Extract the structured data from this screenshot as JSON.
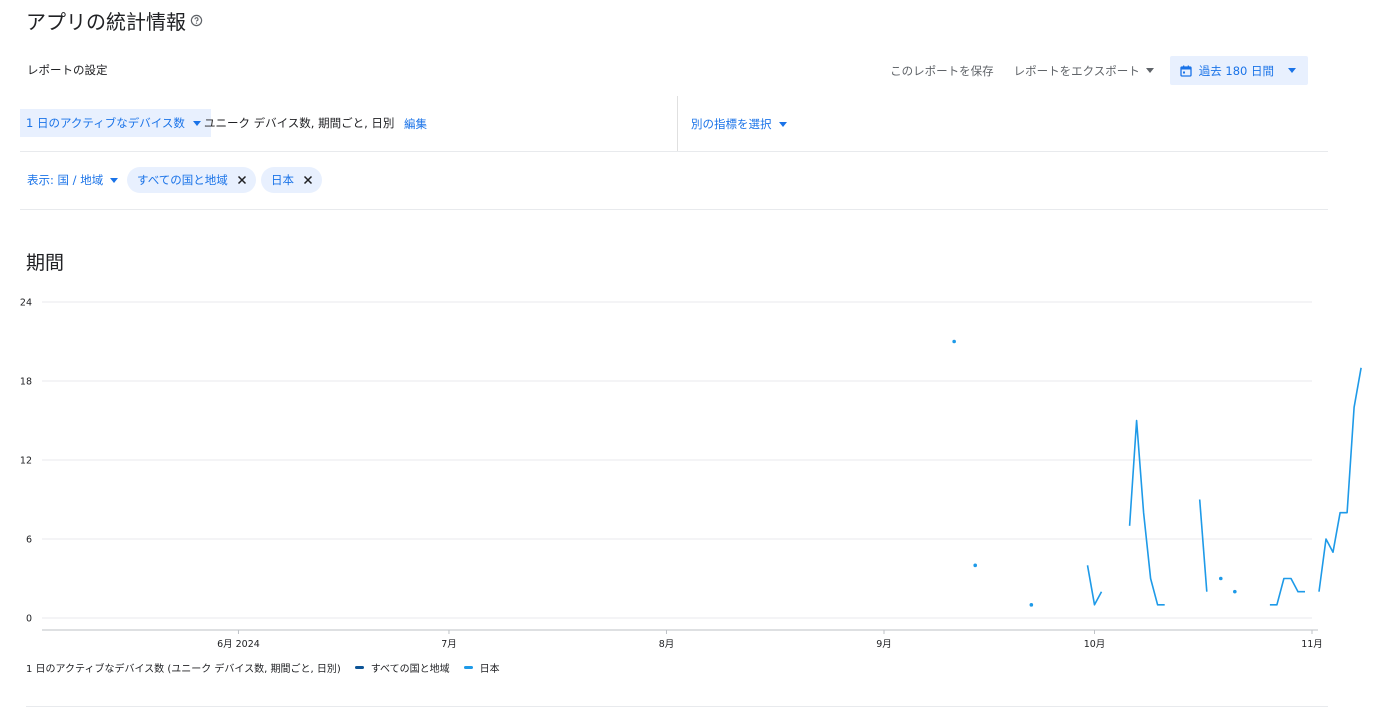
{
  "header": {
    "title": "アプリの統計情報",
    "help_icon": "help-circle-icon"
  },
  "settings": {
    "label": "レポートの設定",
    "save": "このレポートを保存",
    "export": "レポートをエクスポート",
    "date_range": "過去 180 日間",
    "calendar_icon": "calendar-icon"
  },
  "metric": {
    "selected": "1 日のアクティブなデバイス数",
    "description": "ユニーク デバイス数, 期間ごと, 日別",
    "edit": "編集",
    "other": "別の指標を選択"
  },
  "filters": {
    "display": "表示: 国 / 地域",
    "chips": [
      "すべての国と地域",
      "日本"
    ]
  },
  "section": {
    "title": "期間"
  },
  "legend": {
    "metric": "1 日のアクティブなデバイス数 (ユニーク デバイス数, 期間ごと, 日別)"
  },
  "colors": {
    "accent": "#1a73e8",
    "series_all": "#0d5496",
    "series_japan": "#1e9ae8",
    "chip_bg": "#e8f0fe"
  },
  "chart_data": {
    "type": "line",
    "ylim": [
      0,
      24
    ],
    "yticks": [
      0,
      6,
      12,
      18,
      24
    ],
    "x_tick_labels": [
      "6月 2024",
      "7月",
      "8月",
      "9月",
      "10月",
      "11月"
    ],
    "x_tick_dates": [
      "2024-06-01",
      "2024-07-01",
      "2024-08-01",
      "2024-09-01",
      "2024-10-01",
      "2024-11-01"
    ],
    "xlim": [
      "2024-05-04",
      "2024-11-01"
    ],
    "grid": true,
    "legend_position": "bottom-left",
    "series": [
      {
        "name": "すべての国と地域",
        "points": []
      },
      {
        "name": "日本",
        "points": [
          [
            "2024-09-11",
            21
          ],
          [
            "2024-09-14",
            4
          ],
          [
            "2024-09-22",
            1
          ],
          [
            "2024-09-30",
            4
          ],
          [
            "2024-10-01",
            1
          ],
          [
            "2024-10-02",
            2
          ],
          [
            "2024-10-06",
            7
          ],
          [
            "2024-10-07",
            15
          ],
          [
            "2024-10-08",
            8
          ],
          [
            "2024-10-09",
            3
          ],
          [
            "2024-10-10",
            1
          ],
          [
            "2024-10-11",
            1
          ],
          [
            "2024-10-16",
            9
          ],
          [
            "2024-10-17",
            2
          ],
          [
            "2024-10-19",
            3
          ],
          [
            "2024-10-21",
            2
          ],
          [
            "2024-10-26",
            1
          ],
          [
            "2024-10-27",
            1
          ],
          [
            "2024-10-28",
            3
          ],
          [
            "2024-10-29",
            3
          ],
          [
            "2024-10-30",
            2
          ],
          [
            "2024-10-31",
            2
          ],
          [
            "2024-11-02",
            2
          ],
          [
            "2024-11-03",
            6
          ],
          [
            "2024-11-04",
            5
          ],
          [
            "2024-11-05",
            8
          ],
          [
            "2024-11-06",
            8
          ],
          [
            "2024-11-07",
            16
          ],
          [
            "2024-11-08",
            19
          ]
        ]
      }
    ]
  }
}
